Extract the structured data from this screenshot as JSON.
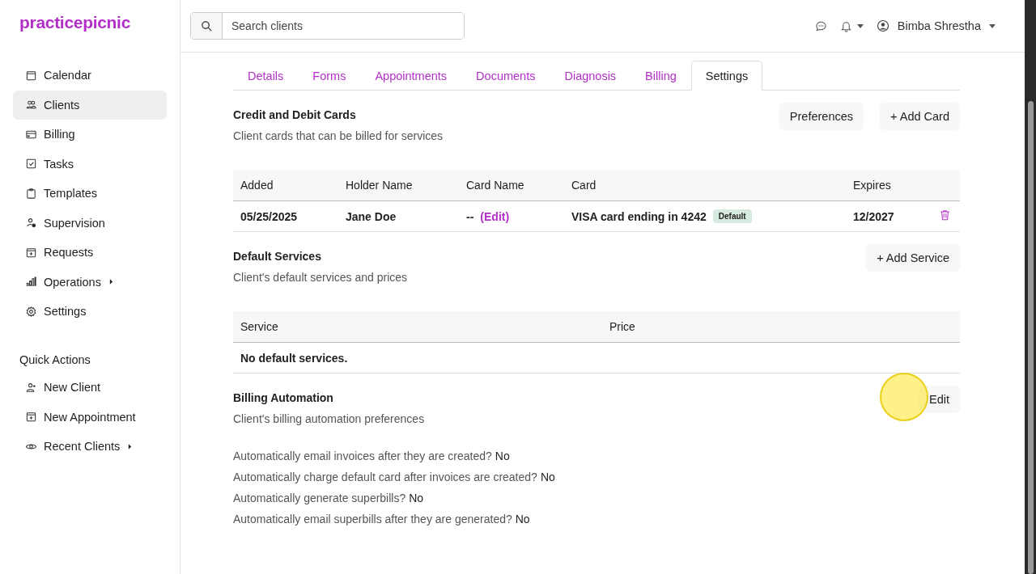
{
  "sidebar": {
    "logo": "practicepicnic",
    "items": [
      {
        "label": "Calendar",
        "selected": false,
        "submenu": false
      },
      {
        "label": "Clients",
        "selected": true,
        "submenu": false
      },
      {
        "label": "Billing",
        "selected": false,
        "submenu": false
      },
      {
        "label": "Tasks",
        "selected": false,
        "submenu": false
      },
      {
        "label": "Templates",
        "selected": false,
        "submenu": false
      },
      {
        "label": "Supervision",
        "selected": false,
        "submenu": false
      },
      {
        "label": "Requests",
        "selected": false,
        "submenu": false
      },
      {
        "label": "Operations",
        "selected": false,
        "submenu": true
      },
      {
        "label": "Settings",
        "selected": false,
        "submenu": false
      }
    ],
    "quick_actions_title": "Quick Actions",
    "quick_actions": [
      {
        "label": "New Client",
        "submenu": false
      },
      {
        "label": "New Appointment",
        "submenu": false
      },
      {
        "label": "Recent Clients",
        "submenu": true
      }
    ]
  },
  "topbar": {
    "search": {
      "placeholder": "Search clients"
    },
    "user": "Bimba Shrestha"
  },
  "tabs": [
    {
      "label": "Details",
      "selected": false
    },
    {
      "label": "Forms",
      "selected": false
    },
    {
      "label": "Appointments",
      "selected": false
    },
    {
      "label": "Documents",
      "selected": false
    },
    {
      "label": "Diagnosis",
      "selected": false
    },
    {
      "label": "Billing",
      "selected": false
    },
    {
      "label": "Settings",
      "selected": true
    }
  ],
  "cards": {
    "title": "Credit and Debit Cards",
    "subtitle": "Client cards that can be billed for services",
    "buttons": [
      "Preferences",
      "+ Add Card"
    ],
    "columns": [
      "Added",
      "Holder Name",
      "Card Name",
      "Card",
      "Expires"
    ],
    "rows": [
      {
        "added": "05/25/2025",
        "holder": "Jane Doe",
        "card_name": "--",
        "edit_link": "(Edit)",
        "card": "VISA card ending in 4242",
        "badge": "Default",
        "expires": "12/2027"
      }
    ]
  },
  "services": {
    "title": "Default Services",
    "subtitle": "Client's default services and prices",
    "button": "+ Add Service",
    "columns": [
      "Service",
      "Price"
    ],
    "empty": "No default services."
  },
  "automation": {
    "title": "Billing Automation",
    "subtitle": "Client's billing automation preferences",
    "button": "Edit",
    "settings": [
      {
        "question": "Automatically email invoices after they are created?",
        "answer": "No"
      },
      {
        "question": "Automatically charge default card after invoices are created?",
        "answer": "No"
      },
      {
        "question": "Automatically generate superbills?",
        "answer": "No"
      },
      {
        "question": "Automatically email superbills after they are generated?",
        "answer": "No"
      }
    ]
  }
}
